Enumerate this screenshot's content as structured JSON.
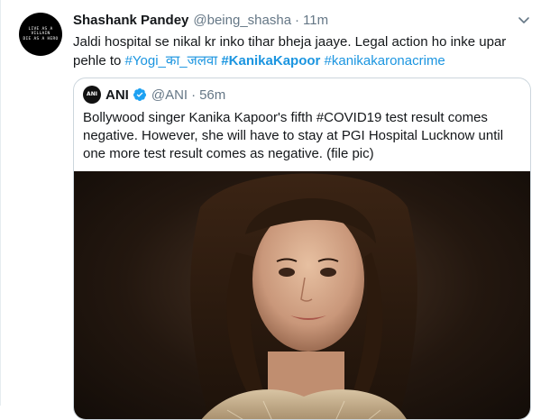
{
  "tweet": {
    "avatar_text": [
      "LIVE AS A",
      "VILLAIN",
      "DIE AS A HERO"
    ],
    "author_name": "Shashank Pandey",
    "author_handle": "@being_shasha",
    "separator": "·",
    "time": "11m",
    "text_plain": "Jaldi hospital se nikal kr inko tihar bheja jaaye. Legal action ho inke upar pehle to ",
    "hashtags": [
      "#Yogi_का_जलवा",
      "#KanikaKapoor",
      "#kanikakaronacrime"
    ],
    "caret_icon": "chevron-down-icon"
  },
  "quote": {
    "avatar_text": "ANI",
    "author_name": "ANI",
    "verified_icon": "verified-badge-icon",
    "author_handle": "@ANI",
    "separator": "·",
    "time": "56m",
    "text": "Bollywood singer Kanika Kapoor's fifth #COVID19 test result comes negative. However, she will have to stay at PGI Hospital Lucknow until one more test result comes as negative. (file pic)"
  },
  "colors": {
    "link": "#1b95e0",
    "secondary_text": "#657786",
    "primary_text": "#14171a",
    "border": "#ccd6dd"
  }
}
